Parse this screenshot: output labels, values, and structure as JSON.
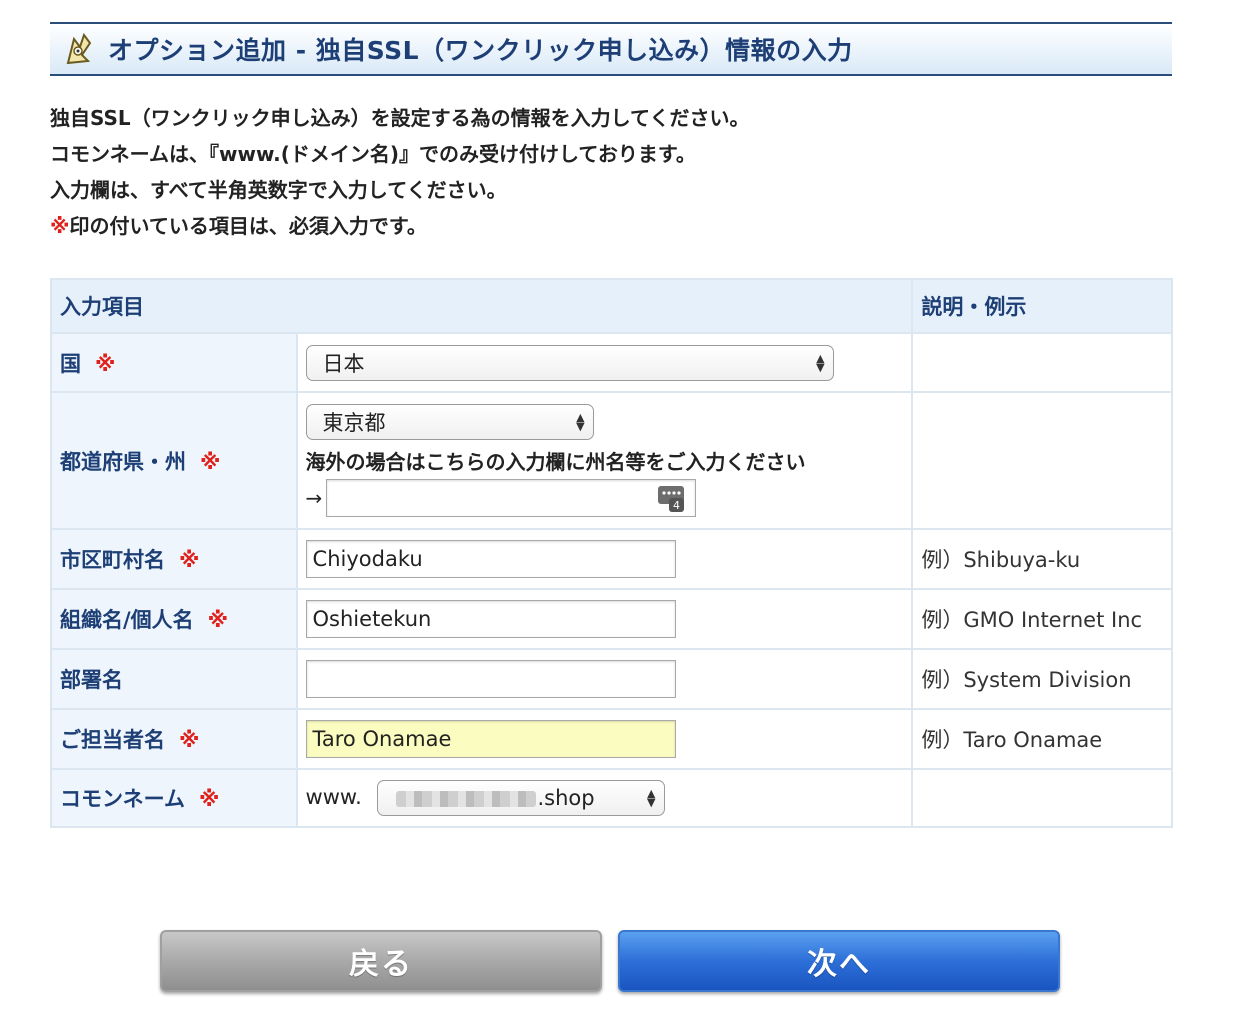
{
  "header": {
    "icon": "mascot-logo-icon",
    "title": "オプション追加 - 独自SSL（ワンクリック申し込み）情報の入力"
  },
  "intro": {
    "line1": "独自SSL（ワンクリック申し込み）を設定する為の情報を入力してください。",
    "line2": "コモンネームは、『www.(ドメイン名)』でのみ受け付けしております。",
    "line3": "入力欄は、すべて半角英数字で入力してください。",
    "line4_mark": "※",
    "line4_rest": "印の付いている項目は、必須入力です。"
  },
  "table": {
    "header_input": "入力項目",
    "header_desc": "説明・例示",
    "required_mark": "※",
    "rows": {
      "country": {
        "label": "国",
        "value": "日本"
      },
      "prefecture": {
        "label": "都道府県・州",
        "value": "東京都",
        "note": "海外の場合はこちらの入力欄に州名等をご入力ください",
        "arrow": "→",
        "overseas_value": ""
      },
      "city": {
        "label": "市区町村名",
        "value": "Chiyodaku",
        "example": "例）Shibuya-ku"
      },
      "organization": {
        "label": "組織名/個人名",
        "value": "Oshietekun",
        "example": "例）GMO Internet Inc"
      },
      "department": {
        "label": "部署名",
        "value": "",
        "example": "例）System Division"
      },
      "contact": {
        "label": "ご担当者名",
        "value": "Taro Onamae",
        "example": "例）Taro Onamae"
      },
      "common_name": {
        "label": "コモンネーム",
        "prefix": "www.",
        "domain_suffix": ".shop"
      }
    }
  },
  "buttons": {
    "back": "戻る",
    "next": "次へ"
  },
  "colors": {
    "header_text": "#1d3f76",
    "required": "#e0201a",
    "highlight_input": "#fbfcbf",
    "next_button": "#2d6fd8",
    "back_button": "#a9a9a9"
  }
}
